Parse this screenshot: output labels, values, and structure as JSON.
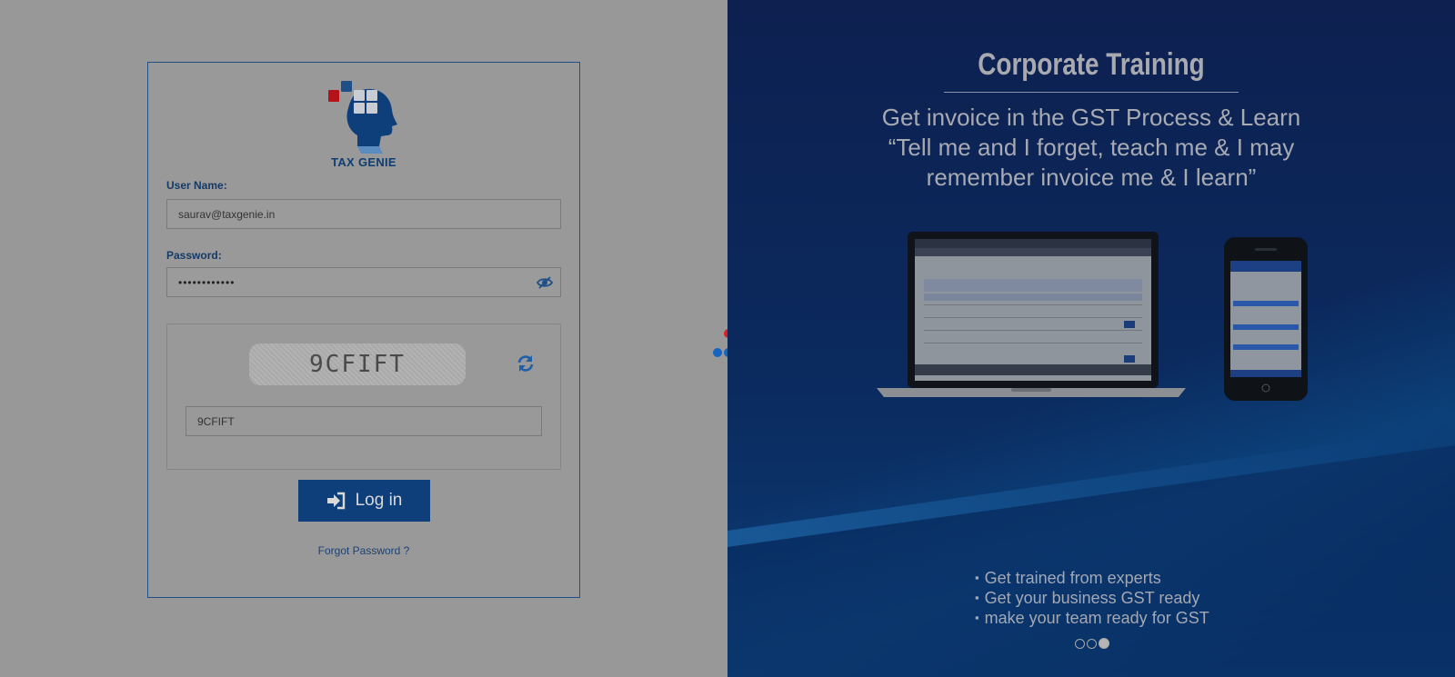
{
  "login": {
    "brand": "TAX GENIE",
    "username_label": "User Name:",
    "username_value": "saurav@taxgenie.in",
    "password_label": "Password:",
    "password_masked": "••••••••••••",
    "captcha_text": "9CFIFT",
    "captcha_input_value": "9CFIFT",
    "login_button": "Log in",
    "forgot_password": "Forgot Password ?"
  },
  "promo": {
    "title": "Corporate Training",
    "quote_lines": [
      "Get invoice in the GST Process &  Learn",
      "“Tell me and I forget, teach me & I may",
      "remember invoice me & I learn”"
    ],
    "bullets": [
      "Get trained from experts",
      "Get your business GST ready",
      "make your team ready for GST"
    ],
    "carousel": {
      "slides": 3,
      "active_index": 3
    }
  },
  "icons": {
    "logo": "tax-genie-head-logo",
    "eye": "eye-toggle-icon",
    "refresh": "refresh-icon",
    "login": "sign-in-icon"
  },
  "colors": {
    "primary": "#0e3f7a",
    "overlay": "#989898",
    "promo_bg": "#0d2050",
    "loader_red": "#e31b23",
    "loader_blue": "#1565c0"
  }
}
